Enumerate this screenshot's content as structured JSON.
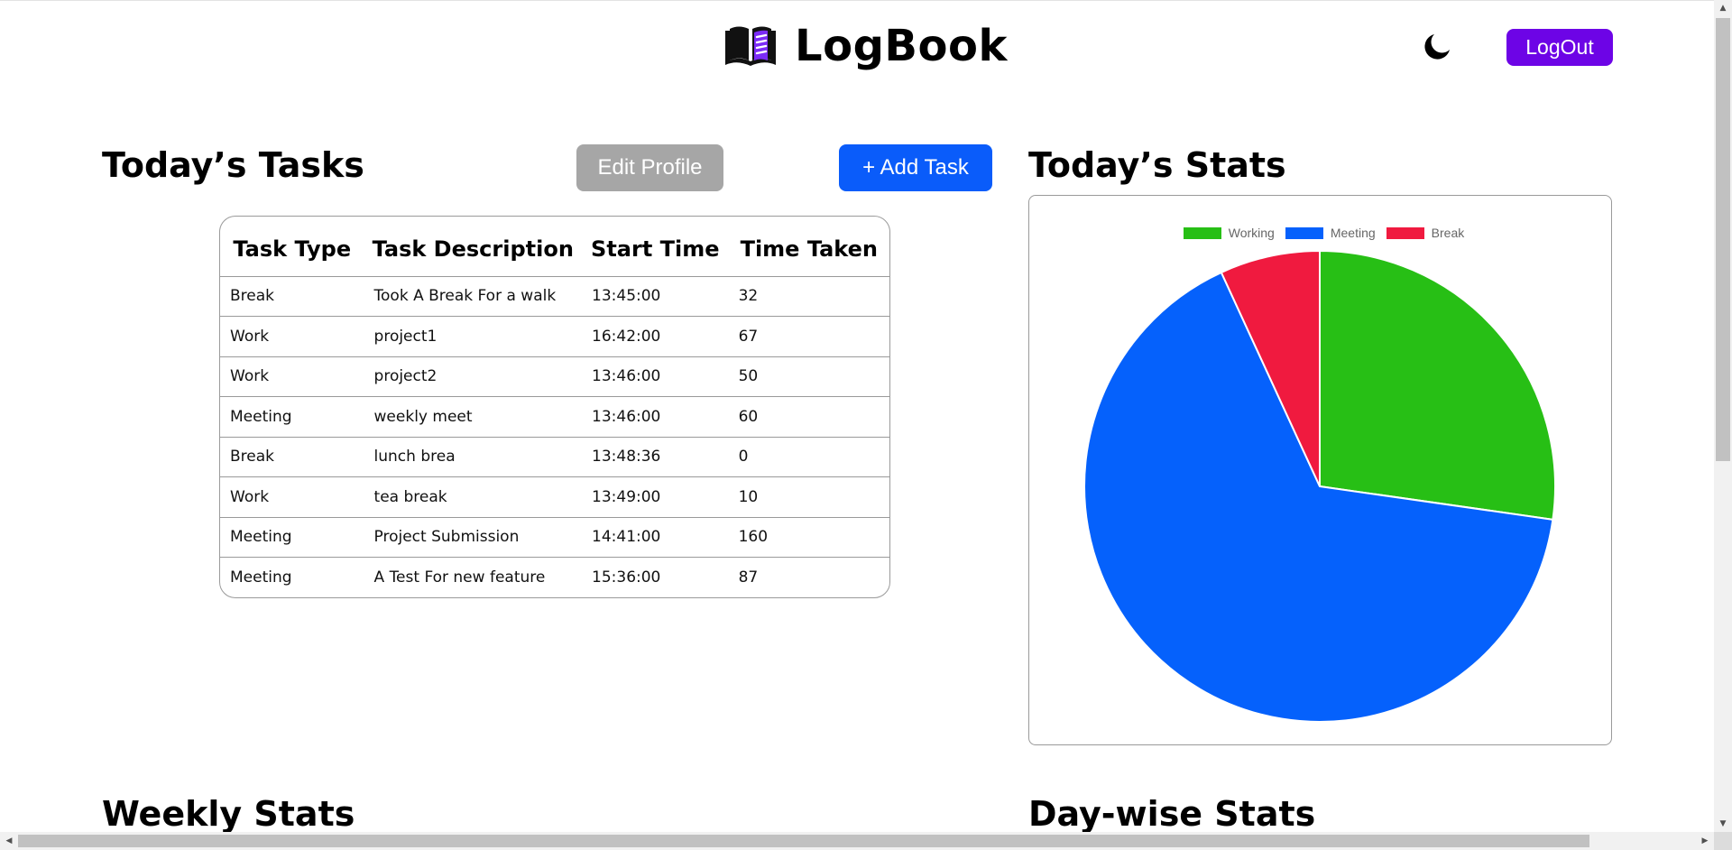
{
  "header": {
    "title": "LogBook",
    "logout_label": "LogOut",
    "brand_icon": "book-icon",
    "theme_icon": "moon-icon",
    "accent_purple": "#6d04e6"
  },
  "tasks": {
    "title": "Today’s Tasks",
    "edit_profile_label": "Edit Profile",
    "add_task_label": "+ Add Task",
    "columns": [
      "Task Type",
      "Task Description",
      "Start Time",
      "Time Taken"
    ],
    "rows": [
      [
        "Break",
        "Took A Break For a walk",
        "13:45:00",
        "32"
      ],
      [
        "Work",
        "project1",
        "16:42:00",
        "67"
      ],
      [
        "Work",
        "project2",
        "13:46:00",
        "50"
      ],
      [
        "Meeting",
        "weekly meet",
        "13:46:00",
        "60"
      ],
      [
        "Break",
        "lunch brea",
        "13:48:36",
        "0"
      ],
      [
        "Work",
        "tea break",
        "13:49:00",
        "10"
      ],
      [
        "Meeting",
        "Project Submission",
        "14:41:00",
        "160"
      ],
      [
        "Meeting",
        "A Test For new feature",
        "15:36:00",
        "87"
      ]
    ]
  },
  "stats": {
    "title": "Today’s Stats"
  },
  "weekly": {
    "title": "Weekly Stats"
  },
  "daywise": {
    "title": "Day-wise Stats"
  },
  "chart_data": {
    "type": "pie",
    "categories": [
      "Working",
      "Meeting",
      "Break"
    ],
    "values": [
      127,
      307,
      32
    ],
    "colors": [
      "#27bf15",
      "#0561fc",
      "#f01a3f"
    ],
    "legend": "top"
  }
}
